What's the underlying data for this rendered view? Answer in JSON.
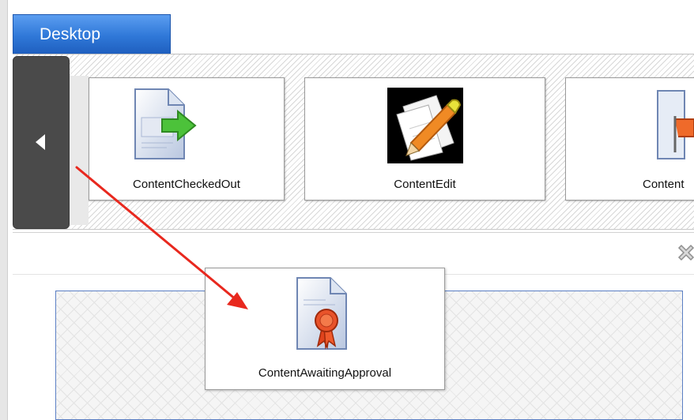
{
  "desktop_tab": {
    "label": "Desktop"
  },
  "nav": {
    "prev_icon": "left-arrow-icon"
  },
  "tray_tiles": [
    {
      "label": "ContentCheckedOut",
      "icon": "document-green-arrow-icon"
    },
    {
      "label": "ContentEdit",
      "icon": "pencil-on-paper-icon"
    },
    {
      "label": "Content",
      "icon": "document-flag-icon"
    }
  ],
  "toolbar": {
    "close_icon": "close-x-icon"
  },
  "dragged_tile": {
    "label": "ContentAwaitingApproval",
    "icon": "document-ribbon-seal-icon"
  },
  "annotation": {
    "arrow_icon": "red-arrow-icon",
    "color": "#e8281e"
  }
}
